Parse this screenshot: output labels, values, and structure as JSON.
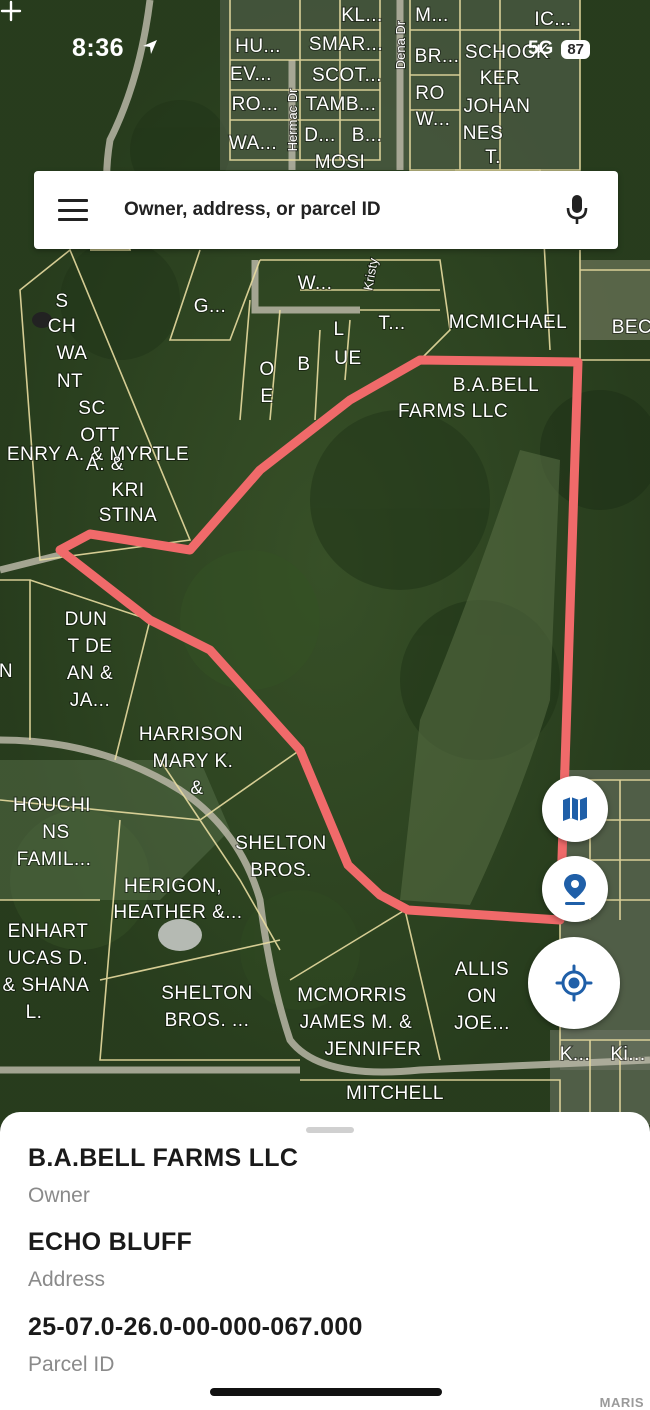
{
  "status_bar": {
    "time": "8:36",
    "network": "5G",
    "battery": "87"
  },
  "search": {
    "placeholder": "Owner, address, or parcel ID"
  },
  "map": {
    "parcel_labels": [
      "KL...",
      "M...",
      "IC...",
      "HU...",
      "SMAR...",
      "BR...",
      "SCHOCK",
      "EV...",
      "SCOT...",
      "KER",
      "RO...",
      "TAMB...",
      "RO",
      "JOHAN",
      "W...",
      "NES",
      "WA...",
      "D...",
      "B...",
      "T.",
      "MOSI",
      "G...",
      "W...",
      "T...",
      "MCMICHAEL",
      "BEC",
      "S",
      "CH",
      "WA",
      "NT",
      "SC",
      "OTT",
      "O",
      "E",
      "B",
      "L",
      "UE",
      "B.A.BELL",
      "FARMS LLC",
      "ENRY A. & MYRTLE",
      "A. &",
      "KRI",
      "STINA",
      "DUN",
      "T DE",
      "AN &",
      "JA...",
      "N",
      "HARRISON",
      "MARY K.",
      "&",
      "HOUCHI",
      "NS",
      "FAMIL...",
      "SHELTON",
      "BROS.",
      "HERIGON,",
      "HEATHER &...",
      "ENHART",
      "UCAS D.",
      "& SHANA",
      "L.",
      "SHELTON",
      "BROS. ...",
      "MCMORRIS",
      "JAMES M. &",
      "JENNIFER",
      "ALLIS",
      "ON",
      "JOE...",
      "MITCHELL",
      "K...",
      "Ki..."
    ],
    "street_labels": [
      "Dena Dr",
      "Hermac Dr",
      "Kristy"
    ],
    "colors": {
      "selected_boundary": "#f06a6a",
      "parcel_lines": "#e8dca0"
    }
  },
  "controls": {
    "layers_icon": "map-icon",
    "pin_icon": "location-pin-icon",
    "locate_icon": "my-location-icon",
    "accent": "#1f5fa8"
  },
  "parcel": {
    "owner": "B.A.BELL FARMS LLC",
    "owner_label": "Owner",
    "address": "ECHO BLUFF",
    "address_label": "Address",
    "parcel_id": "25-07.0-26.0-00-000-067.000",
    "parcel_id_label": "Parcel ID"
  },
  "watermark": "MARIS"
}
